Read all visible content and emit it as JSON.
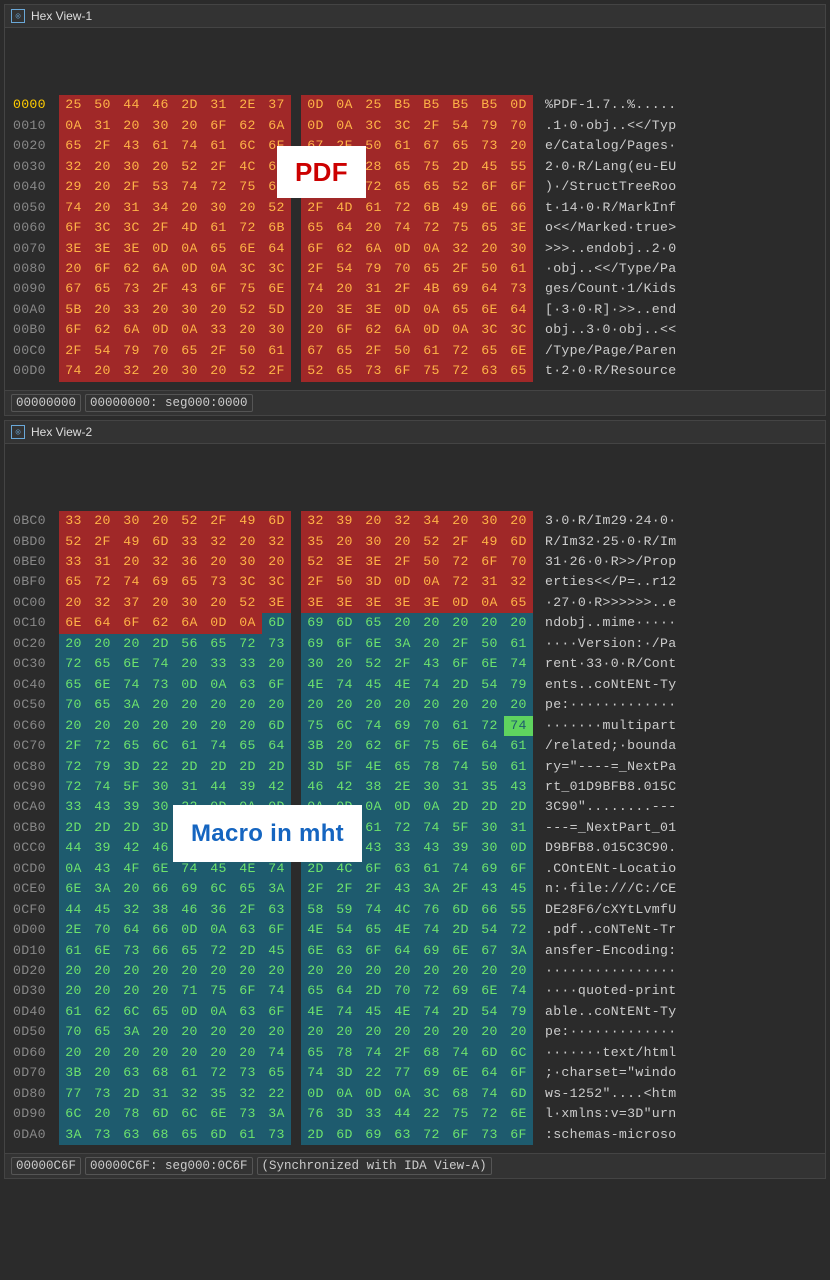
{
  "pane1": {
    "tab_label": "Hex View-1",
    "overlay": "PDF",
    "status": [
      "00000000",
      "00000000: seg000:0000"
    ],
    "rows": [
      {
        "off": "0000",
        "off_hl": true,
        "hex": [
          "25",
          "50",
          "44",
          "46",
          "2D",
          "31",
          "2E",
          "37",
          "0D",
          "0A",
          "25",
          "B5",
          "B5",
          "B5",
          "B5",
          "0D"
        ],
        "bg": "red",
        "ascii": "%PDF-1.7..%....."
      },
      {
        "off": "0010",
        "hex": [
          "0A",
          "31",
          "20",
          "30",
          "20",
          "6F",
          "62",
          "6A",
          "0D",
          "0A",
          "3C",
          "3C",
          "2F",
          "54",
          "79",
          "70"
        ],
        "bg": "red",
        "ascii": ".1·0·obj..<</Typ"
      },
      {
        "off": "0020",
        "hex": [
          "65",
          "2F",
          "43",
          "61",
          "74",
          "61",
          "6C",
          "6F",
          "67",
          "2F",
          "50",
          "61",
          "67",
          "65",
          "73",
          "20"
        ],
        "bg": "red",
        "ascii": "e/Catalog/Pages·"
      },
      {
        "off": "0030",
        "hex": [
          "32",
          "20",
          "30",
          "20",
          "52",
          "2F",
          "4C",
          "61",
          "6E",
          "67",
          "28",
          "65",
          "75",
          "2D",
          "45",
          "55"
        ],
        "bg": "red",
        "ascii": "2·0·R/Lang(eu-EU"
      },
      {
        "off": "0040",
        "hex": [
          "29",
          "20",
          "2F",
          "53",
          "74",
          "72",
          "75",
          "63",
          "74",
          "54",
          "72",
          "65",
          "65",
          "52",
          "6F",
          "6F"
        ],
        "bg": "red",
        "ascii": ")·/StructTreeRoo"
      },
      {
        "off": "0050",
        "hex": [
          "74",
          "20",
          "31",
          "34",
          "20",
          "30",
          "20",
          "52",
          "2F",
          "4D",
          "61",
          "72",
          "6B",
          "49",
          "6E",
          "66"
        ],
        "bg": "red",
        "ascii": "t·14·0·R/MarkInf"
      },
      {
        "off": "0060",
        "hex": [
          "6F",
          "3C",
          "3C",
          "2F",
          "4D",
          "61",
          "72",
          "6B",
          "65",
          "64",
          "20",
          "74",
          "72",
          "75",
          "65",
          "3E"
        ],
        "bg": "red",
        "ascii": "o<</Marked·true>"
      },
      {
        "off": "0070",
        "hex": [
          "3E",
          "3E",
          "3E",
          "0D",
          "0A",
          "65",
          "6E",
          "64",
          "6F",
          "62",
          "6A",
          "0D",
          "0A",
          "32",
          "20",
          "30"
        ],
        "bg": "red",
        "ascii": ">>>..endobj..2·0"
      },
      {
        "off": "0080",
        "hex": [
          "20",
          "6F",
          "62",
          "6A",
          "0D",
          "0A",
          "3C",
          "3C",
          "2F",
          "54",
          "79",
          "70",
          "65",
          "2F",
          "50",
          "61"
        ],
        "bg": "red",
        "ascii": "·obj..<</Type/Pa"
      },
      {
        "off": "0090",
        "hex": [
          "67",
          "65",
          "73",
          "2F",
          "43",
          "6F",
          "75",
          "6E",
          "74",
          "20",
          "31",
          "2F",
          "4B",
          "69",
          "64",
          "73"
        ],
        "bg": "red",
        "ascii": "ges/Count·1/Kids"
      },
      {
        "off": "00A0",
        "hex": [
          "5B",
          "20",
          "33",
          "20",
          "30",
          "20",
          "52",
          "5D",
          "20",
          "3E",
          "3E",
          "0D",
          "0A",
          "65",
          "6E",
          "64"
        ],
        "bg": "red",
        "ascii": "[·3·0·R]·>>..end"
      },
      {
        "off": "00B0",
        "hex": [
          "6F",
          "62",
          "6A",
          "0D",
          "0A",
          "33",
          "20",
          "30",
          "20",
          "6F",
          "62",
          "6A",
          "0D",
          "0A",
          "3C",
          "3C"
        ],
        "bg": "red",
        "ascii": "obj..3·0·obj..<<"
      },
      {
        "off": "00C0",
        "hex": [
          "2F",
          "54",
          "79",
          "70",
          "65",
          "2F",
          "50",
          "61",
          "67",
          "65",
          "2F",
          "50",
          "61",
          "72",
          "65",
          "6E"
        ],
        "bg": "red",
        "ascii": "/Type/Page/Paren"
      },
      {
        "off": "00D0",
        "hex": [
          "74",
          "20",
          "32",
          "20",
          "30",
          "20",
          "52",
          "2F",
          "52",
          "65",
          "73",
          "6F",
          "75",
          "72",
          "63",
          "65"
        ],
        "bg": "red",
        "ascii": "t·2·0·R/Resource"
      }
    ]
  },
  "pane2": {
    "tab_label": "Hex View-2",
    "overlay": "Macro in mht",
    "status": [
      "00000C6F",
      "00000C6F: seg000:0C6F",
      "(Synchronized with IDA View-A)"
    ],
    "rows": [
      {
        "off": "0BC0",
        "hex": [
          "33",
          "20",
          "30",
          "20",
          "52",
          "2F",
          "49",
          "6D",
          "32",
          "39",
          "20",
          "32",
          "34",
          "20",
          "30",
          "20"
        ],
        "bg": "red",
        "ascii": "3·0·R/Im29·24·0·"
      },
      {
        "off": "0BD0",
        "hex": [
          "52",
          "2F",
          "49",
          "6D",
          "33",
          "32",
          "20",
          "32",
          "35",
          "20",
          "30",
          "20",
          "52",
          "2F",
          "49",
          "6D"
        ],
        "bg": "red",
        "ascii": "R/Im32·25·0·R/Im"
      },
      {
        "off": "0BE0",
        "hex": [
          "33",
          "31",
          "20",
          "32",
          "36",
          "20",
          "30",
          "20",
          "52",
          "3E",
          "3E",
          "2F",
          "50",
          "72",
          "6F",
          "70"
        ],
        "bg": "red",
        "ascii": "31·26·0·R>>/Prop"
      },
      {
        "off": "0BF0",
        "hex": [
          "65",
          "72",
          "74",
          "69",
          "65",
          "73",
          "3C",
          "3C",
          "2F",
          "50",
          "3D",
          "0D",
          "0A",
          "72",
          "31",
          "32"
        ],
        "bg": "red",
        "ascii": "erties<</P=..r12"
      },
      {
        "off": "0C00",
        "hex": [
          "20",
          "32",
          "37",
          "20",
          "30",
          "20",
          "52",
          "3E",
          "3E",
          "3E",
          "3E",
          "3E",
          "3E",
          "0D",
          "0A",
          "65"
        ],
        "bg": "red",
        "ascii": "·27·0·R>>>>>>..e"
      },
      {
        "off": "0C10",
        "hex": [
          "6E",
          "64",
          "6F",
          "62",
          "6A",
          "0D",
          "0A",
          "6D",
          "69",
          "6D",
          "65",
          "20",
          "20",
          "20",
          "20",
          "20"
        ],
        "split": 7,
        "ascii": "ndobj..mime·····"
      },
      {
        "off": "0C20",
        "hex": [
          "20",
          "20",
          "20",
          "2D",
          "56",
          "65",
          "72",
          "73",
          "69",
          "6F",
          "6E",
          "3A",
          "20",
          "2F",
          "50",
          "61"
        ],
        "bg": "blue",
        "ascii": "····Version:·/Pa"
      },
      {
        "off": "0C30",
        "hex": [
          "72",
          "65",
          "6E",
          "74",
          "20",
          "33",
          "33",
          "20",
          "30",
          "20",
          "52",
          "2F",
          "43",
          "6F",
          "6E",
          "74"
        ],
        "bg": "blue",
        "ascii": "rent·33·0·R/Cont"
      },
      {
        "off": "0C40",
        "hex": [
          "65",
          "6E",
          "74",
          "73",
          "0D",
          "0A",
          "63",
          "6F",
          "4E",
          "74",
          "45",
          "4E",
          "74",
          "2D",
          "54",
          "79"
        ],
        "bg": "blue",
        "ascii": "ents..coNtENt-Ty"
      },
      {
        "off": "0C50",
        "hex": [
          "70",
          "65",
          "3A",
          "20",
          "20",
          "20",
          "20",
          "20",
          "20",
          "20",
          "20",
          "20",
          "20",
          "20",
          "20",
          "20"
        ],
        "bg": "blue",
        "ascii": "pe:·············"
      },
      {
        "off": "0C60",
        "hex": [
          "20",
          "20",
          "20",
          "20",
          "20",
          "20",
          "20",
          "6D",
          "75",
          "6C",
          "74",
          "69",
          "70",
          "61",
          "72",
          "74"
        ],
        "bg": "blue",
        "hilite": 15,
        "ascii": "·······multipart"
      },
      {
        "off": "0C70",
        "hex": [
          "2F",
          "72",
          "65",
          "6C",
          "61",
          "74",
          "65",
          "64",
          "3B",
          "20",
          "62",
          "6F",
          "75",
          "6E",
          "64",
          "61"
        ],
        "bg": "blue",
        "ascii": "/related;·bounda"
      },
      {
        "off": "0C80",
        "hex": [
          "72",
          "79",
          "3D",
          "22",
          "2D",
          "2D",
          "2D",
          "2D",
          "3D",
          "5F",
          "4E",
          "65",
          "78",
          "74",
          "50",
          "61"
        ],
        "bg": "blue",
        "ascii": "ry=\"----=_NextPa"
      },
      {
        "off": "0C90",
        "hex": [
          "72",
          "74",
          "5F",
          "30",
          "31",
          "44",
          "39",
          "42",
          "46",
          "42",
          "38",
          "2E",
          "30",
          "31",
          "35",
          "43"
        ],
        "bg": "blue",
        "ascii": "rt_01D9BFB8.015C"
      },
      {
        "off": "0CA0",
        "hex": [
          "33",
          "43",
          "39",
          "30",
          "22",
          "0D",
          "0A",
          "0D",
          "0A",
          "0D",
          "0A",
          "0D",
          "0A",
          "2D",
          "2D",
          "2D"
        ],
        "bg": "blue",
        "ascii": "3C90\"........---"
      },
      {
        "off": "0CB0",
        "hex": [
          "2D",
          "2D",
          "2D",
          "3D",
          "5F",
          "4E",
          "65",
          "78",
          "74",
          "50",
          "61",
          "72",
          "74",
          "5F",
          "30",
          "31"
        ],
        "bg": "blue",
        "ascii": "---=_NextPart_01"
      },
      {
        "off": "0CC0",
        "hex": [
          "44",
          "39",
          "42",
          "46",
          "42",
          "38",
          "2E",
          "30",
          "31",
          "35",
          "43",
          "33",
          "43",
          "39",
          "30",
          "0D"
        ],
        "bg": "blue",
        "ascii": "D9BFB8.015C3C90."
      },
      {
        "off": "0CD0",
        "hex": [
          "0A",
          "43",
          "4F",
          "6E",
          "74",
          "45",
          "4E",
          "74",
          "2D",
          "4C",
          "6F",
          "63",
          "61",
          "74",
          "69",
          "6F"
        ],
        "bg": "blue",
        "ascii": ".COntENt-Locatio"
      },
      {
        "off": "0CE0",
        "hex": [
          "6E",
          "3A",
          "20",
          "66",
          "69",
          "6C",
          "65",
          "3A",
          "2F",
          "2F",
          "2F",
          "43",
          "3A",
          "2F",
          "43",
          "45"
        ],
        "bg": "blue",
        "ascii": "n:·file:///C:/CE"
      },
      {
        "off": "0CF0",
        "hex": [
          "44",
          "45",
          "32",
          "38",
          "46",
          "36",
          "2F",
          "63",
          "58",
          "59",
          "74",
          "4C",
          "76",
          "6D",
          "66",
          "55"
        ],
        "bg": "blue",
        "ascii": "DE28F6/cXYtLvmfU"
      },
      {
        "off": "0D00",
        "hex": [
          "2E",
          "70",
          "64",
          "66",
          "0D",
          "0A",
          "63",
          "6F",
          "4E",
          "54",
          "65",
          "4E",
          "74",
          "2D",
          "54",
          "72"
        ],
        "bg": "blue",
        "ascii": ".pdf..coNTeNt-Tr"
      },
      {
        "off": "0D10",
        "hex": [
          "61",
          "6E",
          "73",
          "66",
          "65",
          "72",
          "2D",
          "45",
          "6E",
          "63",
          "6F",
          "64",
          "69",
          "6E",
          "67",
          "3A"
        ],
        "bg": "blue",
        "ascii": "ansfer-Encoding:"
      },
      {
        "off": "0D20",
        "hex": [
          "20",
          "20",
          "20",
          "20",
          "20",
          "20",
          "20",
          "20",
          "20",
          "20",
          "20",
          "20",
          "20",
          "20",
          "20",
          "20"
        ],
        "bg": "blue",
        "ascii": "················"
      },
      {
        "off": "0D30",
        "hex": [
          "20",
          "20",
          "20",
          "20",
          "71",
          "75",
          "6F",
          "74",
          "65",
          "64",
          "2D",
          "70",
          "72",
          "69",
          "6E",
          "74"
        ],
        "bg": "blue",
        "ascii": "····quoted-print"
      },
      {
        "off": "0D40",
        "hex": [
          "61",
          "62",
          "6C",
          "65",
          "0D",
          "0A",
          "63",
          "6F",
          "4E",
          "74",
          "45",
          "4E",
          "74",
          "2D",
          "54",
          "79"
        ],
        "bg": "blue",
        "ascii": "able..coNtENt-Ty"
      },
      {
        "off": "0D50",
        "hex": [
          "70",
          "65",
          "3A",
          "20",
          "20",
          "20",
          "20",
          "20",
          "20",
          "20",
          "20",
          "20",
          "20",
          "20",
          "20",
          "20"
        ],
        "bg": "blue",
        "ascii": "pe:·············"
      },
      {
        "off": "0D60",
        "hex": [
          "20",
          "20",
          "20",
          "20",
          "20",
          "20",
          "20",
          "74",
          "65",
          "78",
          "74",
          "2F",
          "68",
          "74",
          "6D",
          "6C"
        ],
        "bg": "blue",
        "ascii": "·······text/html"
      },
      {
        "off": "0D70",
        "hex": [
          "3B",
          "20",
          "63",
          "68",
          "61",
          "72",
          "73",
          "65",
          "74",
          "3D",
          "22",
          "77",
          "69",
          "6E",
          "64",
          "6F"
        ],
        "bg": "blue",
        "ascii": ";·charset=\"windo"
      },
      {
        "off": "0D80",
        "hex": [
          "77",
          "73",
          "2D",
          "31",
          "32",
          "35",
          "32",
          "22",
          "0D",
          "0A",
          "0D",
          "0A",
          "3C",
          "68",
          "74",
          "6D"
        ],
        "bg": "blue",
        "ascii": "ws-1252\"....<htm"
      },
      {
        "off": "0D90",
        "hex": [
          "6C",
          "20",
          "78",
          "6D",
          "6C",
          "6E",
          "73",
          "3A",
          "76",
          "3D",
          "33",
          "44",
          "22",
          "75",
          "72",
          "6E"
        ],
        "bg": "blue",
        "ascii": "l·xmlns:v=3D\"urn"
      },
      {
        "off": "0DA0",
        "hex": [
          "3A",
          "73",
          "63",
          "68",
          "65",
          "6D",
          "61",
          "73",
          "2D",
          "6D",
          "69",
          "63",
          "72",
          "6F",
          "73",
          "6F"
        ],
        "bg": "blue",
        "ascii": ":schemas-microso"
      }
    ]
  }
}
